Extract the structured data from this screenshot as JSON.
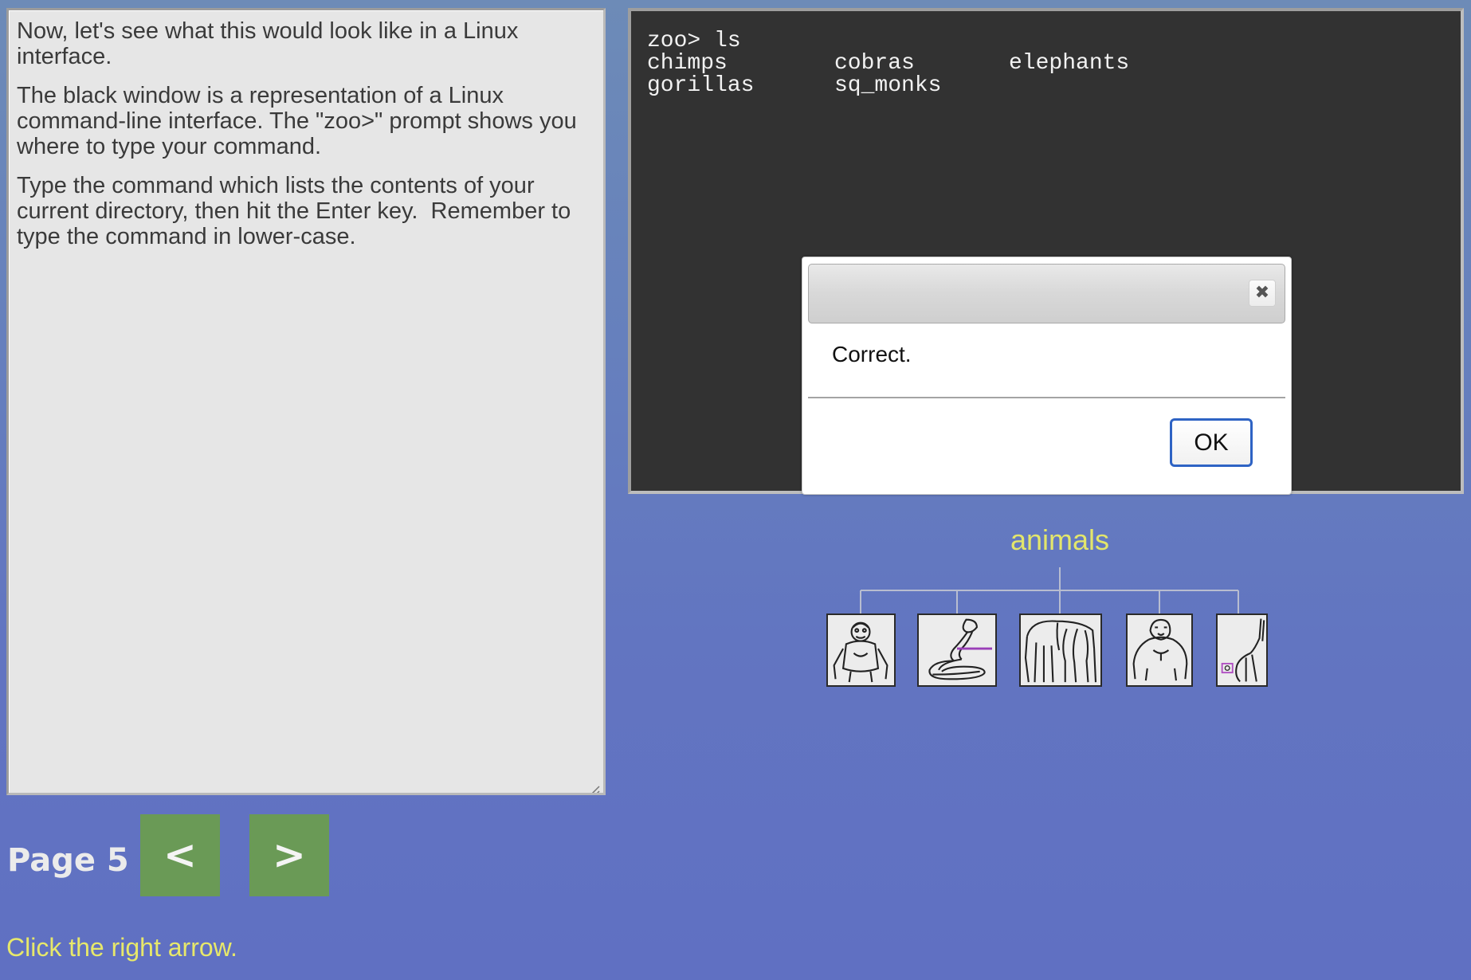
{
  "instructions": {
    "paragraphs": [
      "Now, let's see what this would look like in a Linux interface.",
      "The black window is a representation of a Linux command-line interface. The \"zoo>\" prompt shows you where to type your command.",
      "Type the command which lists the contents of your current directory, then hit the Enter key.  Remember to type the command in lower-case."
    ]
  },
  "pager": {
    "page_label": "Page 5",
    "prev_label": "<",
    "next_label": ">"
  },
  "hint": "Click the right arrow.",
  "terminal": {
    "command_line": "zoo> ls",
    "rows": [
      [
        "chimps",
        "cobras",
        "elephants"
      ],
      [
        "gorillas",
        "sq_monks",
        ""
      ]
    ]
  },
  "dialog": {
    "message": "Correct.",
    "close_glyph": "✖",
    "ok_label": "OK"
  },
  "directory": {
    "name": "animals",
    "children": [
      {
        "name": "chimps",
        "icon": "chimp-icon"
      },
      {
        "name": "cobras",
        "icon": "cobra-icon"
      },
      {
        "name": "elephants",
        "icon": "elephant-icon"
      },
      {
        "name": "gorillas",
        "icon": "gorilla-icon"
      },
      {
        "name": "sq_monks",
        "icon": "squirrel-monkey-icon"
      }
    ]
  },
  "colors": {
    "terminal_bg": "#323232",
    "panel_bg": "#e6e6e6",
    "nav_button": "#6a9a56",
    "accent_yellow": "#e3e66b",
    "dialog_ok_border": "#2e63c4"
  }
}
